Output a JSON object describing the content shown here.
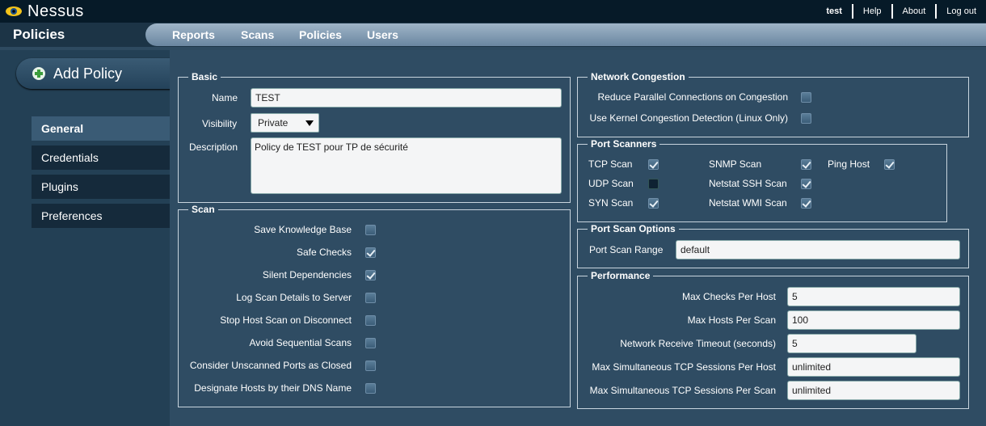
{
  "app": {
    "logo_text": "Nessus"
  },
  "toplinks": {
    "user": "test",
    "help": "Help",
    "about": "About",
    "logout": "Log out"
  },
  "navbar": {
    "section_title": "Policies",
    "items": [
      "Reports",
      "Scans",
      "Policies",
      "Users"
    ]
  },
  "sidebar": {
    "add_policy": "Add Policy",
    "items": [
      "General",
      "Credentials",
      "Plugins",
      "Preferences"
    ],
    "active": "General"
  },
  "basic": {
    "legend": "Basic",
    "name_label": "Name",
    "name_value": "TEST",
    "visibility_label": "Visibility",
    "visibility_value": "Private",
    "description_label": "Description",
    "description_value": "Policy de TEST pour TP de sécurité"
  },
  "scan": {
    "legend": "Scan",
    "options": [
      {
        "label": "Save Knowledge Base",
        "checked": false
      },
      {
        "label": "Safe Checks",
        "checked": true
      },
      {
        "label": "Silent Dependencies",
        "checked": true
      },
      {
        "label": "Log Scan Details to Server",
        "checked": false
      },
      {
        "label": "Stop Host Scan on Disconnect",
        "checked": false
      },
      {
        "label": "Avoid Sequential Scans",
        "checked": false
      },
      {
        "label": "Consider Unscanned Ports as Closed",
        "checked": false
      },
      {
        "label": "Designate Hosts by their DNS Name",
        "checked": false
      }
    ]
  },
  "network_congestion": {
    "legend": "Network Congestion",
    "options": [
      {
        "label": "Reduce Parallel Connections on Congestion",
        "checked": false
      },
      {
        "label": "Use Kernel Congestion Detection (Linux Only)",
        "checked": false
      }
    ]
  },
  "port_scanners": {
    "legend": "Port Scanners",
    "options": [
      {
        "label": "TCP Scan",
        "checked": true
      },
      {
        "label": "UDP Scan",
        "checked": false,
        "state": "highlighted"
      },
      {
        "label": "SYN Scan",
        "checked": true
      },
      {
        "label": "SNMP Scan",
        "checked": true
      },
      {
        "label": "Netstat SSH Scan",
        "checked": true
      },
      {
        "label": "Netstat WMI Scan",
        "checked": true
      },
      {
        "label": "Ping Host",
        "checked": true
      }
    ]
  },
  "port_scan_options": {
    "legend": "Port Scan Options",
    "range_label": "Port Scan Range",
    "range_value": "default"
  },
  "performance": {
    "legend": "Performance",
    "fields": [
      {
        "label": "Max Checks Per Host",
        "value": "5"
      },
      {
        "label": "Max Hosts Per Scan",
        "value": "100"
      },
      {
        "label": "Network Receive Timeout (seconds)",
        "value": "5"
      },
      {
        "label": "Max Simultaneous TCP Sessions Per Host",
        "value": "unlimited"
      },
      {
        "label": "Max Simultaneous TCP Sessions Per Scan",
        "value": "unlimited"
      }
    ]
  },
  "colors": {
    "accent_green": "#3c9c3c",
    "background": "#2f4c63",
    "topbar": "#061a28"
  }
}
